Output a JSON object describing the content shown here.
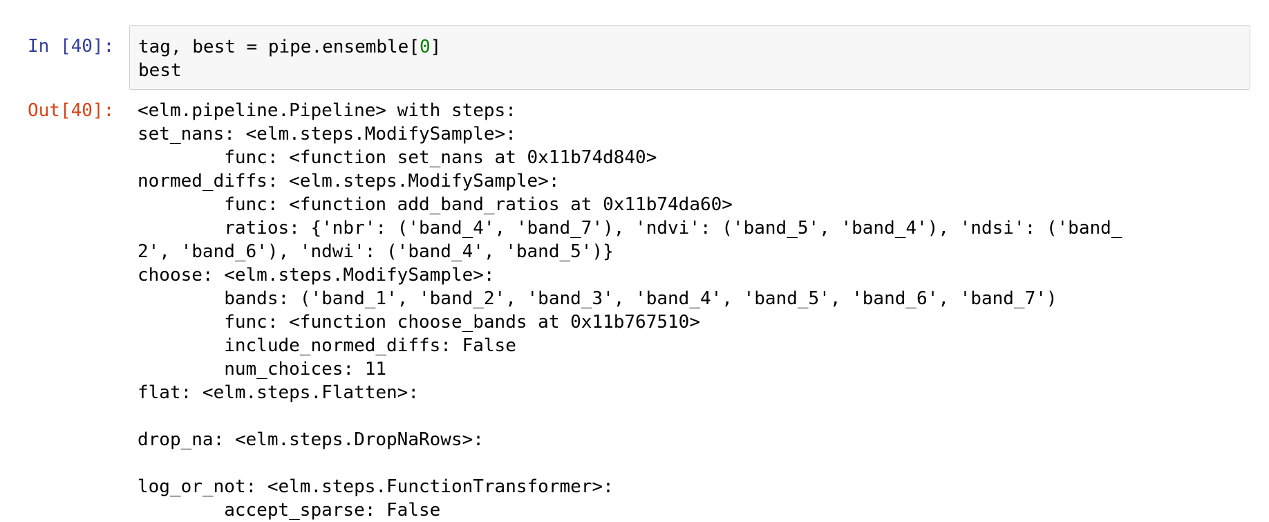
{
  "input_cell": {
    "prompt": "In [40]:",
    "code_line_1_pre": "tag, best = pipe.ensemble[",
    "code_line_1_num": "0",
    "code_line_1_post": "]",
    "code_line_2": "best"
  },
  "output_cell": {
    "prompt": "Out[40]:",
    "lines": [
      "<elm.pipeline.Pipeline> with steps:",
      "set_nans: <elm.steps.ModifySample>:",
      "        func: <function set_nans at 0x11b74d840>",
      "normed_diffs: <elm.steps.ModifySample>:",
      "        func: <function add_band_ratios at 0x11b74da60>",
      "        ratios: {'nbr': ('band_4', 'band_7'), 'ndvi': ('band_5', 'band_4'), 'ndsi': ('band_",
      "2', 'band_6'), 'ndwi': ('band_4', 'band_5')}",
      "choose: <elm.steps.ModifySample>:",
      "        bands: ('band_1', 'band_2', 'band_3', 'band_4', 'band_5', 'band_6', 'band_7')",
      "        func: <function choose_bands at 0x11b767510>",
      "        include_normed_diffs: False",
      "        num_choices: 11",
      "flat: <elm.steps.Flatten>:",
      "",
      "drop_na: <elm.steps.DropNaRows>:",
      "",
      "log_or_not: <elm.steps.FunctionTransformer>:",
      "        accept_sparse: False"
    ]
  }
}
